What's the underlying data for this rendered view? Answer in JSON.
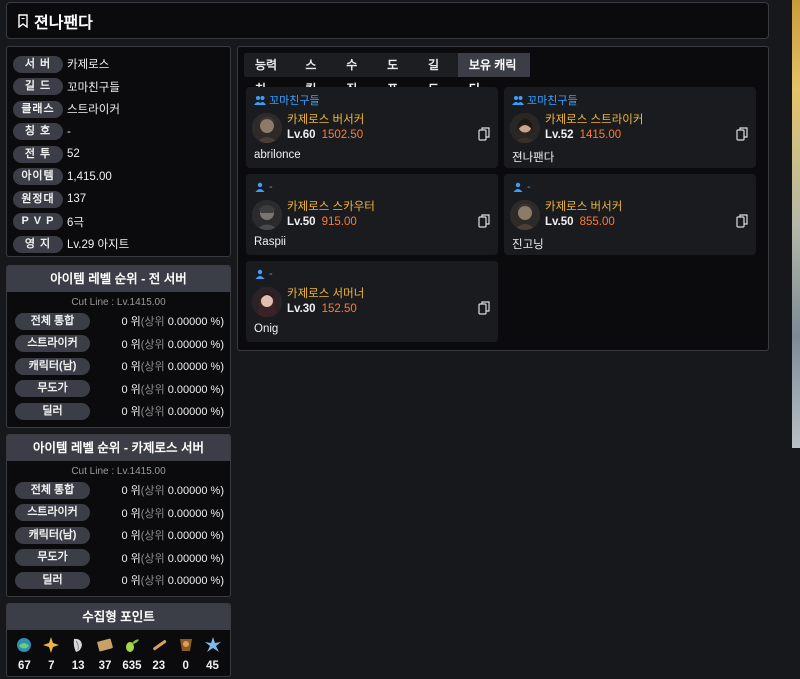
{
  "header": {
    "icon": "bookmark-icon",
    "title": "젼나팬다"
  },
  "profile": {
    "rows": [
      {
        "label": "서  버",
        "value": "카제로스"
      },
      {
        "label": "길  드",
        "value": "꼬마친구들"
      },
      {
        "label": "클래스",
        "value": "스트라이커"
      },
      {
        "label": "칭  호",
        "value": "-"
      },
      {
        "label": "전  투",
        "value": "52"
      },
      {
        "label": "아이템",
        "value": "1,415.00"
      },
      {
        "label": "원정대",
        "value": "137"
      },
      {
        "label": "P V P",
        "value": "6극"
      },
      {
        "label": "영  지",
        "value": "Lv.29 아지트"
      }
    ]
  },
  "rank_all": {
    "title": "아이템 레벨 순위 - 전 서버",
    "cutline": "Cut Line : Lv.1415.00",
    "rows": [
      {
        "label": "전체 통합",
        "rank": "0 위",
        "pct_label": "(상위",
        "pct": "0.00000 %)"
      },
      {
        "label": "스트라이커",
        "rank": "0 위",
        "pct_label": "(상위",
        "pct": "0.00000 %)"
      },
      {
        "label": "캐릭터(남)",
        "rank": "0 위",
        "pct_label": "(상위",
        "pct": "0.00000 %)"
      },
      {
        "label": "무도가",
        "rank": "0 위",
        "pct_label": "(상위",
        "pct": "0.00000 %)"
      },
      {
        "label": "딜러",
        "rank": "0 위",
        "pct_label": "(상위",
        "pct": "0.00000 %)"
      }
    ]
  },
  "rank_server": {
    "title": "아이템 레벨 순위 - 카제로스 서버",
    "cutline": "Cut Line : Lv.1415.00",
    "rows": [
      {
        "label": "전체 통합",
        "rank": "0 위",
        "pct_label": "(상위",
        "pct": "0.00000 %)"
      },
      {
        "label": "스트라이커",
        "rank": "0 위",
        "pct_label": "(상위",
        "pct": "0.00000 %)"
      },
      {
        "label": "캐릭터(남)",
        "rank": "0 위",
        "pct_label": "(상위",
        "pct": "0.00000 %)"
      },
      {
        "label": "무도가",
        "rank": "0 위",
        "pct_label": "(상위",
        "pct": "0.00000 %)"
      },
      {
        "label": "딜러",
        "rank": "0 위",
        "pct_label": "(상위",
        "pct": "0.00000 %)"
      }
    ]
  },
  "collection": {
    "title": "수집형 포인트",
    "items": [
      {
        "icon": "island-heart-icon",
        "value": "67"
      },
      {
        "icon": "star-icon",
        "value": "7"
      },
      {
        "icon": "seed-icon",
        "value": "13"
      },
      {
        "icon": "artwork-icon",
        "value": "37"
      },
      {
        "icon": "mokoko-seed-icon",
        "value": "635"
      },
      {
        "icon": "voyage-icon",
        "value": "23"
      },
      {
        "icon": "world-tree-icon",
        "value": "0"
      },
      {
        "icon": "orgel-icon",
        "value": "45"
      }
    ]
  },
  "tabs": [
    "능력치",
    "스킬",
    "수집",
    "도표",
    "길드",
    "보유 캐릭터"
  ],
  "active_tab": 5,
  "characters": [
    {
      "guild": "꼬마친구들",
      "guild_icon": "group-icon",
      "server": "카제로스",
      "job": "버서커",
      "level": "Lv.60",
      "ilvl": "1502.50",
      "name": "abrilonce",
      "avatar": "berserker"
    },
    {
      "guild": "꼬마친구들",
      "guild_icon": "group-icon",
      "server": "카제로스",
      "job": "스트라이커",
      "level": "Lv.52",
      "ilvl": "1415.00",
      "name": "젼나팬다",
      "avatar": "striker"
    },
    {
      "guild": "-",
      "guild_icon": "person-icon",
      "server": "카제로스",
      "job": "스카우터",
      "level": "Lv.50",
      "ilvl": "915.00",
      "name": "Raspii",
      "avatar": "scouter"
    },
    {
      "guild": "-",
      "guild_icon": "person-icon",
      "server": "카제로스",
      "job": "버서커",
      "level": "Lv.50",
      "ilvl": "855.00",
      "name": "진고닝",
      "avatar": "berserker"
    },
    {
      "guild": "-",
      "guild_icon": "person-icon",
      "server": "카제로스",
      "job": "서머너",
      "level": "Lv.30",
      "ilvl": "152.50",
      "name": "Onig",
      "avatar": "summoner"
    }
  ],
  "colors": {
    "accent_blue": "#3aa0ff",
    "item_level_orange": "#ff7a33",
    "class_gold": "#f0b63a",
    "panel_bg": "#0b0b0d",
    "label_bg": "#3b3e46"
  }
}
